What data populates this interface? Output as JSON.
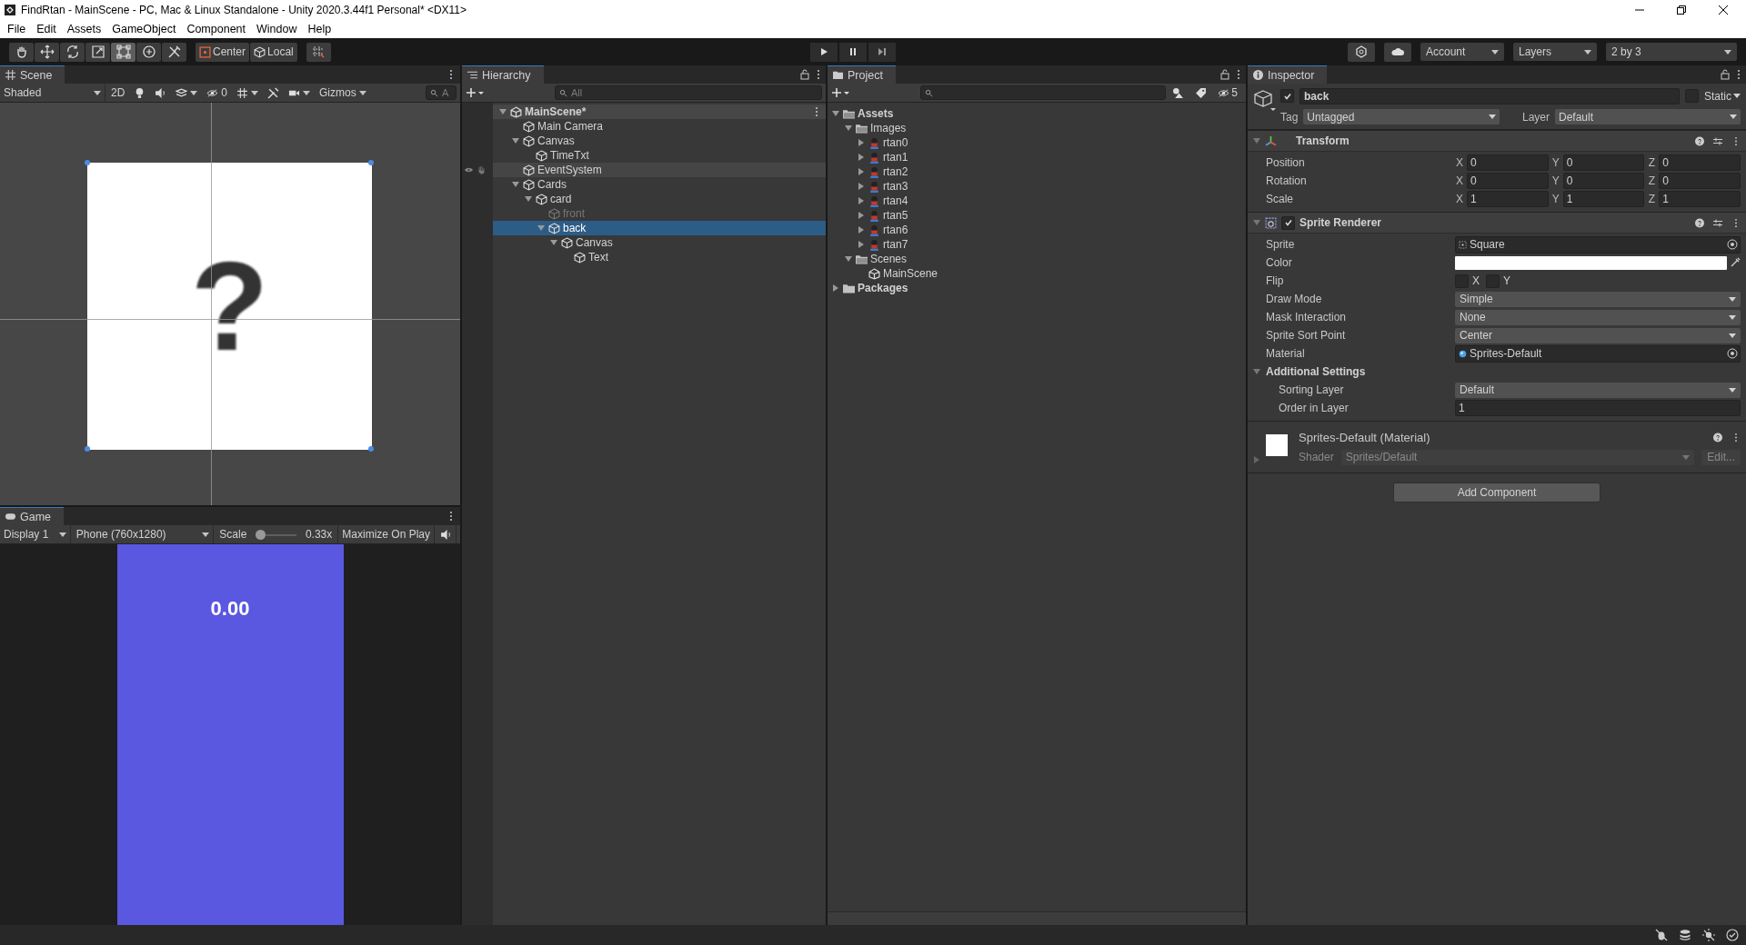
{
  "window": {
    "title": "FindRtan - MainScene - PC, Mac & Linux Standalone - Unity 2020.3.44f1 Personal* <DX11>"
  },
  "menu": [
    "File",
    "Edit",
    "Assets",
    "GameObject",
    "Component",
    "Window",
    "Help"
  ],
  "toolbar": {
    "tools": [
      {
        "kind": "hand",
        "selected": false
      },
      {
        "kind": "move",
        "selected": false
      },
      {
        "kind": "rotate",
        "selected": false
      },
      {
        "kind": "scale",
        "selected": false
      },
      {
        "kind": "rect",
        "selected": true
      },
      {
        "kind": "transform",
        "selected": false
      },
      {
        "kind": "custom",
        "selected": false
      }
    ],
    "pivot": "Center",
    "space": "Local",
    "account": "Account",
    "layers": "Layers",
    "layout": "2 by 3"
  },
  "scene": {
    "tab": "Scene",
    "shading": "Shaded",
    "mode_2d": {
      "label": "2D",
      "on": false
    },
    "hidden_count": "0",
    "gizmos": "Gizmos",
    "search_placeholder": "A",
    "sprite_glyph": "?"
  },
  "game": {
    "tab": "Game",
    "display": "Display 1",
    "resolution": "Phone (760x1280)",
    "scale_label": "Scale",
    "scale_slider": {
      "level": 0
    },
    "scale": "0.33x",
    "maximize": {
      "label": "Maximize On Play",
      "on": false
    },
    "timer": "0.00"
  },
  "hierarchy": {
    "tab": "Hierarchy",
    "search_placeholder": "All",
    "tree": [
      {
        "name": "MainScene*",
        "kind": "scene",
        "expanded": true,
        "selected": false,
        "active": true,
        "hovered": false,
        "children": [
          {
            "name": "Main Camera",
            "kind": "gameobject",
            "selected": false,
            "active": true,
            "hovered": false
          },
          {
            "name": "Canvas",
            "kind": "gameobject",
            "expanded": true,
            "selected": false,
            "active": true,
            "hovered": false,
            "children": [
              {
                "name": "TimeTxt",
                "kind": "gameobject",
                "selected": false,
                "active": true,
                "hovered": false
              }
            ]
          },
          {
            "name": "EventSystem",
            "kind": "gameobject",
            "selected": false,
            "active": true,
            "hovered": true
          },
          {
            "name": "Cards",
            "kind": "gameobject",
            "expanded": true,
            "selected": false,
            "active": true,
            "hovered": false,
            "children": [
              {
                "name": "card",
                "kind": "gameobject",
                "expanded": true,
                "selected": false,
                "active": true,
                "hovered": false,
                "children": [
                  {
                    "name": "front",
                    "kind": "gameobject",
                    "selected": false,
                    "active": false,
                    "hovered": false
                  },
                  {
                    "name": "back",
                    "kind": "gameobject",
                    "expanded": true,
                    "selected": true,
                    "active": true,
                    "hovered": false,
                    "children": [
                      {
                        "name": "Canvas",
                        "kind": "gameobject",
                        "expanded": true,
                        "selected": false,
                        "active": true,
                        "hovered": false,
                        "children": [
                          {
                            "name": "Text",
                            "kind": "gameobject",
                            "selected": false,
                            "active": true,
                            "hovered": false
                          }
                        ]
                      }
                    ]
                  }
                ]
              }
            ]
          }
        ]
      }
    ]
  },
  "project": {
    "tab": "Project",
    "hidden_count": "5",
    "tree": [
      {
        "name": "Assets",
        "kind": "folder",
        "expanded": true,
        "children": [
          {
            "name": "Images",
            "kind": "folder",
            "expanded": true,
            "children": [
              {
                "name": "rtan0",
                "kind": "sprite",
                "expanded": false
              },
              {
                "name": "rtan1",
                "kind": "sprite",
                "expanded": false
              },
              {
                "name": "rtan2",
                "kind": "sprite",
                "expanded": false
              },
              {
                "name": "rtan3",
                "kind": "sprite",
                "expanded": false
              },
              {
                "name": "rtan4",
                "kind": "sprite",
                "expanded": false
              },
              {
                "name": "rtan5",
                "kind": "sprite",
                "expanded": false
              },
              {
                "name": "rtan6",
                "kind": "sprite",
                "expanded": false
              },
              {
                "name": "rtan7",
                "kind": "sprite",
                "expanded": false
              }
            ]
          },
          {
            "name": "Scenes",
            "kind": "folder",
            "expanded": true,
            "children": [
              {
                "name": "MainScene",
                "kind": "scene"
              }
            ]
          }
        ]
      },
      {
        "name": "Packages",
        "kind": "folder",
        "expanded": false
      }
    ]
  },
  "inspector": {
    "tab": "Inspector",
    "object": {
      "name": "back",
      "active": true,
      "static_label": "Static",
      "static": false,
      "tag_label": "Tag",
      "tag": "Untagged",
      "layer_label": "Layer",
      "layer": "Default"
    },
    "transform": {
      "title": "Transform",
      "rows": [
        {
          "label": "Position",
          "values": [
            {
              "axis": "X",
              "value": "0"
            },
            {
              "axis": "Y",
              "value": "0"
            },
            {
              "axis": "Z",
              "value": "0"
            }
          ]
        },
        {
          "label": "Rotation",
          "values": [
            {
              "axis": "X",
              "value": "0"
            },
            {
              "axis": "Y",
              "value": "0"
            },
            {
              "axis": "Z",
              "value": "0"
            }
          ]
        },
        {
          "label": "Scale",
          "values": [
            {
              "axis": "X",
              "value": "1"
            },
            {
              "axis": "Y",
              "value": "1"
            },
            {
              "axis": "Z",
              "value": "1"
            }
          ]
        }
      ]
    },
    "sprite_renderer": {
      "title": "Sprite Renderer",
      "enabled": true,
      "fields": [
        {
          "kind": "sprite",
          "label": "Sprite",
          "value": "Square"
        },
        {
          "kind": "color",
          "label": "Color",
          "color": "#ffffff"
        },
        {
          "kind": "flip",
          "label": "Flip",
          "options": [
            {
              "label": "X",
              "checked": false
            },
            {
              "label": "Y",
              "checked": false
            }
          ]
        },
        {
          "kind": "dropdown",
          "label": "Draw Mode",
          "value": "Simple"
        },
        {
          "kind": "dropdown",
          "label": "Mask Interaction",
          "value": "None"
        },
        {
          "kind": "dropdown",
          "label": "Sprite Sort Point",
          "value": "Center"
        },
        {
          "kind": "material",
          "label": "Material",
          "value": "Sprites-Default"
        },
        {
          "kind": "section",
          "label": "Additional Settings",
          "expanded": true
        },
        {
          "kind": "dropdown",
          "label": "Sorting Layer",
          "value": "Default",
          "indented": true
        },
        {
          "kind": "number",
          "label": "Order in Layer",
          "value": "1",
          "indented": true
        }
      ]
    },
    "material": {
      "title": "Sprites-Default (Material)",
      "shader_label": "Shader",
      "shader": "Sprites/Default",
      "edit": "Edit..."
    },
    "add_component": "Add Component"
  }
}
